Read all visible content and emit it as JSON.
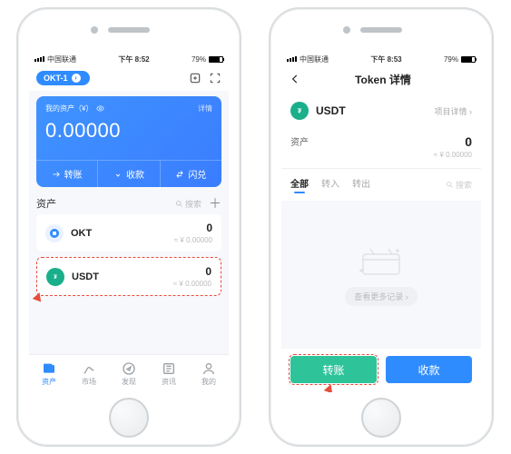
{
  "left": {
    "status": {
      "carrier": "中国联通",
      "time": "下午 8:52",
      "battery": "79%"
    },
    "wallet_pill": "OKT-1",
    "card": {
      "label": "我的资产（¥）",
      "details": "详情",
      "balance": "0.00000",
      "actions": {
        "transfer": "转账",
        "receive": "收款",
        "swap": "闪兑"
      }
    },
    "assets_header": "资产",
    "search_placeholder": "搜索",
    "assets": [
      {
        "symbol": "OKT",
        "value": "0",
        "sub": "≈ ¥ 0.00000"
      },
      {
        "symbol": "USDT",
        "value": "0",
        "sub": "≈ ¥ 0.00000"
      }
    ],
    "tabs": [
      "资产",
      "市场",
      "发现",
      "资讯",
      "我的"
    ]
  },
  "right": {
    "status": {
      "carrier": "中国联通",
      "time": "下午 8:53",
      "battery": "79%"
    },
    "title": "Token 详情",
    "token_name": "USDT",
    "project_details": "项目详情 ›",
    "balance_label": "资产",
    "balance_value": "0",
    "balance_sub": "≈ ¥ 0.00000",
    "tabs": [
      "全部",
      "转入",
      "转出"
    ],
    "search_placeholder": "搜索",
    "more_records": "查看更多记录 ›",
    "buttons": {
      "transfer": "转账",
      "receive": "收款"
    }
  }
}
